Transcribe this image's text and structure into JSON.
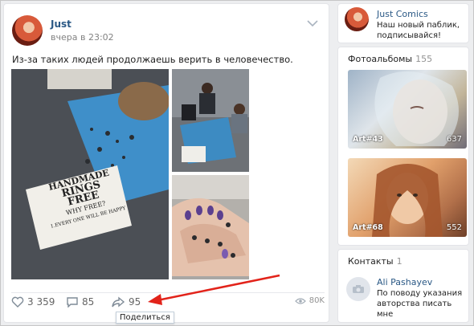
{
  "post": {
    "author": "Just",
    "time": "вчера в 23:02",
    "text": "Из-за таких людей продолжаешь верить в человечество.",
    "photo_sign_lines": [
      "HANDMADE",
      "RINGS",
      "FREE",
      "WHY FREE?",
      "1.EVERY ONE WILL BE HAPPY"
    ],
    "actions": {
      "likes": "3 359",
      "comments": "85",
      "shares": "95",
      "views": "80K"
    },
    "share_tooltip": "Поделиться"
  },
  "sidebar": {
    "group_name": "Just Comics",
    "group_status": "Наш новый паблик, подписывайся!",
    "albums_title": "Фотоальбомы",
    "albums_count": "155",
    "albums": [
      {
        "name": "Art#43",
        "count": "637"
      },
      {
        "name": "Art#68",
        "count": "552"
      }
    ],
    "contacts_title": "Контакты",
    "contacts_count": "1",
    "contact_name": "Ali Pashayev",
    "contact_desc": "По поводу указания авторства писать мне"
  },
  "colors": {
    "link": "#2a5885",
    "accent_arrow": "#e2231a"
  }
}
